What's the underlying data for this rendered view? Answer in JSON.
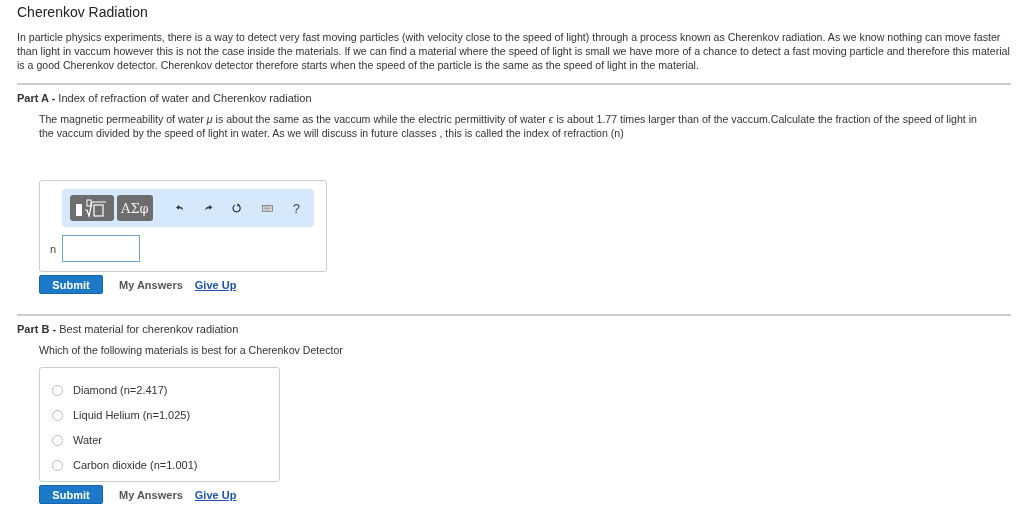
{
  "title": "Cherenkov Radiation",
  "intro": "In particle physics experiments, there is a way to detect very fast moving particles (with velocity close to the speed of light) through a process known as Cherenkov radiation. As we know nothing can move faster than light in vaccum however this is not the case inside the materials. If we can find a material where the speed of light is small we have more of a chance to detect a fast moving particle and therefore this material is a good Cherenkov detector. Cherenkov detector therefore starts when the speed of  the particle is the same as the speed of light in the material.",
  "parts": [
    {
      "kind": "expression",
      "heading": "**Part A -** Index of refraction of water and Cherenkov radiation",
      "prompt": "The magnetic permeability of water  *μ* is about the same as the vaccum while the electric permittivity of  water  *ϵ* is about 1.77 times larger than of the vaccum.Calculate the fraction of the speed of light in the vaccum divided by the speed of light in water. As we will discuss in future classes , this is called the index of refraction (n)",
      "symbols_button": "ΑΣφ",
      "help": "?",
      "variable": "n",
      "actions": {
        "submit": "Submit",
        "answers": "My Answers",
        "give_up": "Give Up"
      }
    },
    {
      "kind": "choice",
      "heading": "**Part B -** Best material for cherenkov radiation",
      "prompt": "Which of the following materials is best for a Cherenkov Detector",
      "options": [
        {
          "label": "Diamond (n=2.417)",
          "selected": false
        },
        {
          "label": "Liquid Helium (n=1.025)",
          "selected": false
        },
        {
          "label": "Water",
          "selected": false
        },
        {
          "label": "Carbon dioxide (n=1.001)",
          "selected": false
        }
      ],
      "actions": {
        "submit": "Submit",
        "answers": "My Answers",
        "give_up": "Give Up"
      }
    }
  ]
}
